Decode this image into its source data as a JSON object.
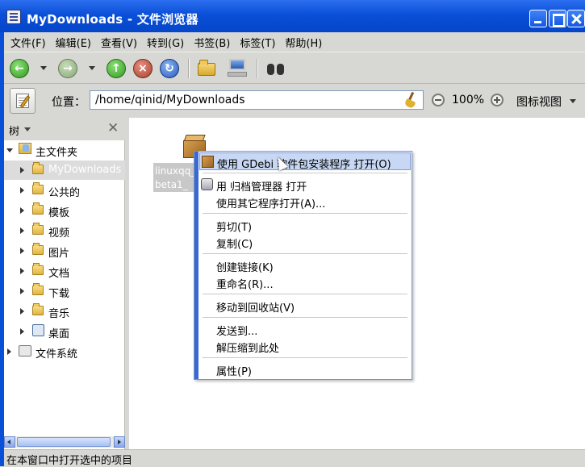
{
  "window": {
    "title": "MyDownloads - 文件浏览器"
  },
  "menubar": [
    {
      "label": "文件(F)"
    },
    {
      "label": "编辑(E)"
    },
    {
      "label": "查看(V)"
    },
    {
      "label": "转到(G)"
    },
    {
      "label": "书签(B)"
    },
    {
      "label": "标签(T)"
    },
    {
      "label": "帮助(H)"
    }
  ],
  "toolbar": {
    "icons": [
      "back-arrow-icon",
      "forward-arrow-icon",
      "up-arrow-icon",
      "stop-icon",
      "reload-icon",
      "home-folder-icon",
      "computer-icon",
      "binoculars-search-icon"
    ]
  },
  "location": {
    "label": "位置：",
    "path": "/home/qinid/MyDownloads",
    "zoom": "100%",
    "view_mode": "图标视图"
  },
  "sidebar": {
    "header": "树",
    "items": [
      {
        "label": "主文件夹",
        "level": 0,
        "expanded": true
      },
      {
        "label": "MyDownloads",
        "level": 1,
        "selected": true
      },
      {
        "label": "公共的",
        "level": 1
      },
      {
        "label": "模板",
        "level": 1
      },
      {
        "label": "视频",
        "level": 1
      },
      {
        "label": "图片",
        "level": 1
      },
      {
        "label": "文档",
        "level": 1
      },
      {
        "label": "下载",
        "level": 1
      },
      {
        "label": "音乐",
        "level": 1
      },
      {
        "label": "桌面",
        "level": 1
      },
      {
        "label": "文件系统",
        "level": 0
      }
    ]
  },
  "content": {
    "file": {
      "label_line1": "linuxqq_",
      "label_line2": "beta1_"
    }
  },
  "context_menu": {
    "items": [
      {
        "label": "使用 GDebi 软件包安装程序 打开(O)",
        "icon": "package-icon",
        "highlighted": true
      },
      {
        "label": "用 归档管理器 打开",
        "icon": "archive-manager-icon"
      },
      {
        "label": "使用其它程序打开(A)..."
      },
      {
        "label": "剪切(T)"
      },
      {
        "label": "复制(C)"
      },
      {
        "label": "创建链接(K)"
      },
      {
        "label": "重命名(R)..."
      },
      {
        "label": "移动到回收站(V)"
      },
      {
        "label": "发送到..."
      },
      {
        "label": "解压缩到此处"
      },
      {
        "label": "属性(P)"
      }
    ]
  },
  "statusbar": {
    "text": "在本窗口中打开选中的项目"
  }
}
